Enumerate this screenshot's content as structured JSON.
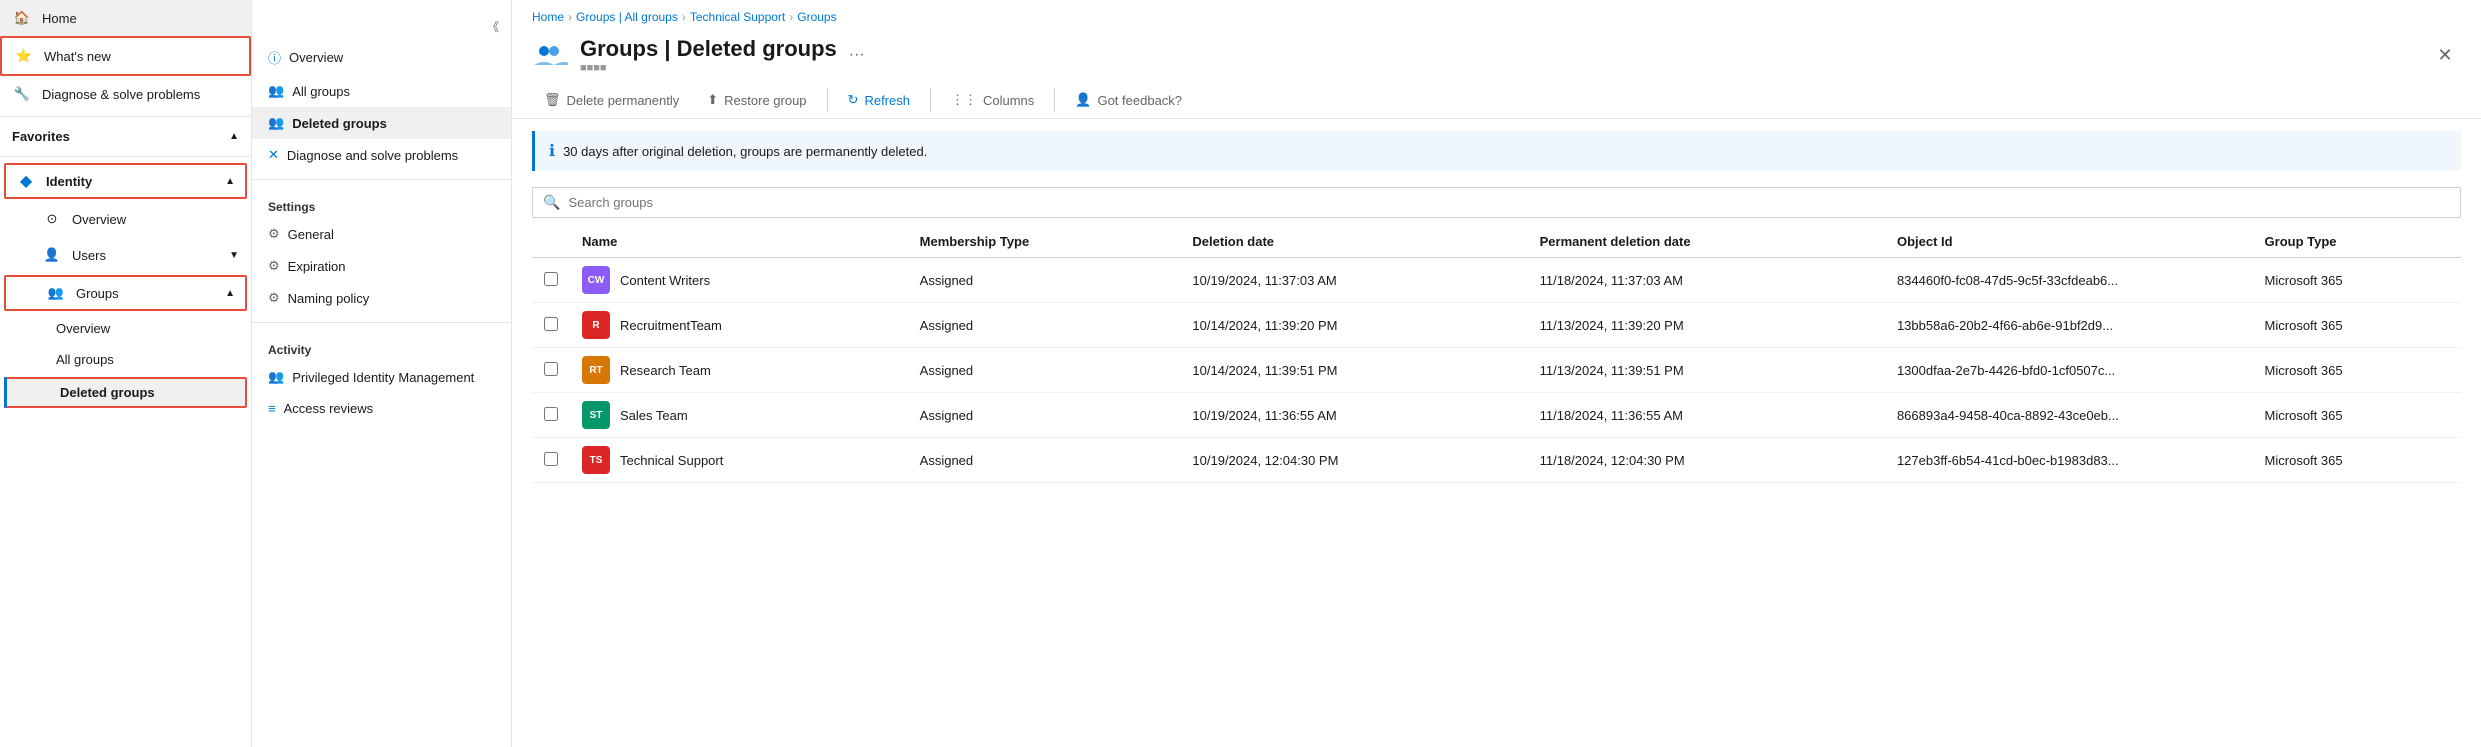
{
  "sidebar": {
    "items": [
      {
        "id": "home",
        "label": "Home",
        "icon": "🏠",
        "level": 0,
        "active": false
      },
      {
        "id": "whats-new",
        "label": "What's new",
        "icon": "⭐",
        "level": 0,
        "active": false,
        "highlighted": true
      },
      {
        "id": "diagnose",
        "label": "Diagnose & solve problems",
        "icon": "🔧",
        "level": 0,
        "active": false
      },
      {
        "id": "favorites",
        "label": "Favorites",
        "icon": "",
        "level": 0,
        "section": true,
        "chevron": "▲"
      },
      {
        "id": "identity",
        "label": "Identity",
        "icon": "◆",
        "level": 0,
        "section": true,
        "chevron": "▲",
        "highlighted": true
      },
      {
        "id": "overview-id",
        "label": "Overview",
        "icon": "⊙",
        "level": 1,
        "sub": true
      },
      {
        "id": "users",
        "label": "Users",
        "icon": "👤",
        "level": 1,
        "sub": true,
        "chevron": "▼"
      },
      {
        "id": "groups",
        "label": "Groups",
        "icon": "👥",
        "level": 1,
        "sub": true,
        "chevron": "▲",
        "highlighted": true
      },
      {
        "id": "overview-grp",
        "label": "Overview",
        "icon": "",
        "level": 2,
        "sub": true
      },
      {
        "id": "all-groups",
        "label": "All groups",
        "icon": "",
        "level": 2,
        "sub": true
      },
      {
        "id": "deleted-groups",
        "label": "Deleted groups",
        "icon": "",
        "level": 2,
        "sub": true,
        "active": true,
        "highlighted": true
      }
    ]
  },
  "leftPanel": {
    "items": [
      {
        "id": "overview",
        "label": "Overview",
        "icon": "ⓘ"
      },
      {
        "id": "all-groups",
        "label": "All groups",
        "icon": "👥"
      },
      {
        "id": "deleted-groups",
        "label": "Deleted groups",
        "icon": "👥",
        "active": true
      }
    ],
    "settingsLabel": "Settings",
    "settingsItems": [
      {
        "id": "general",
        "label": "General",
        "icon": "⚙"
      },
      {
        "id": "expiration",
        "label": "Expiration",
        "icon": "⚙"
      },
      {
        "id": "naming-policy",
        "label": "Naming policy",
        "icon": "⚙"
      }
    ],
    "activityLabel": "Activity",
    "activityItems": [
      {
        "id": "pim",
        "label": "Privileged Identity Management",
        "icon": "👥"
      },
      {
        "id": "access-reviews",
        "label": "Access reviews",
        "icon": "≡"
      }
    ],
    "collapseTitle": "Collapse"
  },
  "breadcrumb": {
    "items": [
      {
        "label": "Home",
        "link": true
      },
      {
        "label": "Groups | All groups",
        "link": true
      },
      {
        "label": "Technical Support",
        "link": true
      },
      {
        "label": "Groups",
        "link": true
      }
    ]
  },
  "pageHeader": {
    "title": "Groups | Deleted groups",
    "subtitle": "■■■■",
    "moreIcon": "···"
  },
  "toolbar": {
    "deletePermanently": "Delete permanently",
    "restoreGroup": "Restore group",
    "refresh": "Refresh",
    "columns": "Columns",
    "feedback": "Got feedback?"
  },
  "infoBanner": {
    "message": "30 days after original deletion, groups are permanently deleted."
  },
  "search": {
    "placeholder": "Search groups"
  },
  "table": {
    "columns": [
      {
        "id": "checkbox",
        "label": ""
      },
      {
        "id": "name",
        "label": "Name"
      },
      {
        "id": "membership-type",
        "label": "Membership Type"
      },
      {
        "id": "deletion-date",
        "label": "Deletion date"
      },
      {
        "id": "permanent-deletion-date",
        "label": "Permanent deletion date"
      },
      {
        "id": "object-id",
        "label": "Object Id"
      },
      {
        "id": "group-type",
        "label": "Group Type"
      }
    ],
    "rows": [
      {
        "name": "Content Writers",
        "initials": "CW",
        "avatarColor": "#8B5CF6",
        "membershipType": "Assigned",
        "deletionDate": "10/19/2024, 11:37:03 AM",
        "permanentDeletionDate": "11/18/2024, 11:37:03 AM",
        "objectId": "834460f0-fc08-47d5-9c5f-33cfdeab6...",
        "groupType": "Microsoft 365"
      },
      {
        "name": "RecruitmentTeam",
        "initials": "R",
        "avatarColor": "#DC2626",
        "membershipType": "Assigned",
        "deletionDate": "10/14/2024, 11:39:20 PM",
        "permanentDeletionDate": "11/13/2024, 11:39:20 PM",
        "objectId": "13bb58a6-20b2-4f66-ab6e-91bf2d9...",
        "groupType": "Microsoft 365"
      },
      {
        "name": "Research Team",
        "initials": "RT",
        "avatarColor": "#D97706",
        "membershipType": "Assigned",
        "deletionDate": "10/14/2024, 11:39:51 PM",
        "permanentDeletionDate": "11/13/2024, 11:39:51 PM",
        "objectId": "1300dfaa-2e7b-4426-bfd0-1cf0507c...",
        "groupType": "Microsoft 365"
      },
      {
        "name": "Sales Team",
        "initials": "ST",
        "avatarColor": "#059669",
        "membershipType": "Assigned",
        "deletionDate": "10/19/2024, 11:36:55 AM",
        "permanentDeletionDate": "11/18/2024, 11:36:55 AM",
        "objectId": "866893a4-9458-40ca-8892-43ce0eb...",
        "groupType": "Microsoft 365"
      },
      {
        "name": "Technical Support",
        "initials": "TS",
        "avatarColor": "#DC2626",
        "membershipType": "Assigned",
        "deletionDate": "10/19/2024, 12:04:30 PM",
        "permanentDeletionDate": "11/18/2024, 12:04:30 PM",
        "objectId": "127eb3ff-6b54-41cd-b0ec-b1983d83...",
        "groupType": "Microsoft 365"
      }
    ]
  }
}
